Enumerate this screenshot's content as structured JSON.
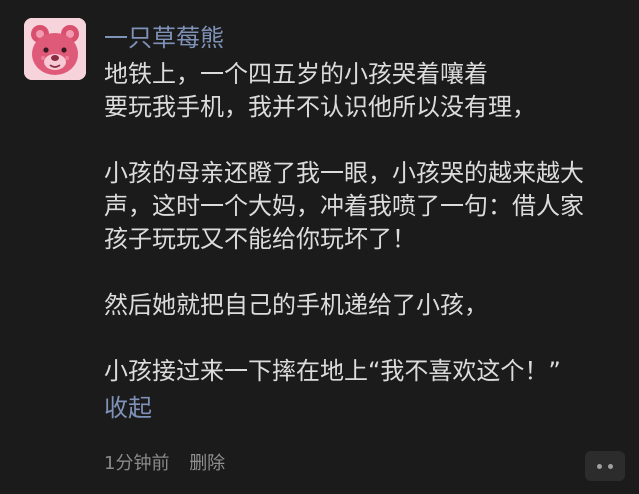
{
  "post": {
    "username": "一只草莓熊",
    "avatar_icon": "strawberry-bear-icon",
    "paragraphs": [
      {
        "lines": [
          "地铁上，一个四五岁的小孩哭着嚷着",
          "要玩我手机，我并不认识他所以没有理，"
        ]
      },
      {
        "lines": [
          "小孩的母亲还瞪了我一眼，小孩哭的越来越大",
          "声，这时一个大妈，冲着我喷了一句：借人家",
          "孩子玩玩又不能给你玩坏了！"
        ]
      },
      {
        "lines": [
          "然后她就把自己的手机递给了小孩，"
        ]
      },
      {
        "lines": [
          "小孩接过来一下摔在地上“我不喜欢这个！”"
        ]
      }
    ],
    "collapse_label": "收起",
    "time": "1分钟前",
    "delete_label": "删除",
    "more_icon": "more-dots-icon"
  },
  "colors": {
    "background": "#1b1b1b",
    "link": "#7f92b8",
    "text": "#dcdcdc",
    "meta": "#8a8a8a"
  }
}
